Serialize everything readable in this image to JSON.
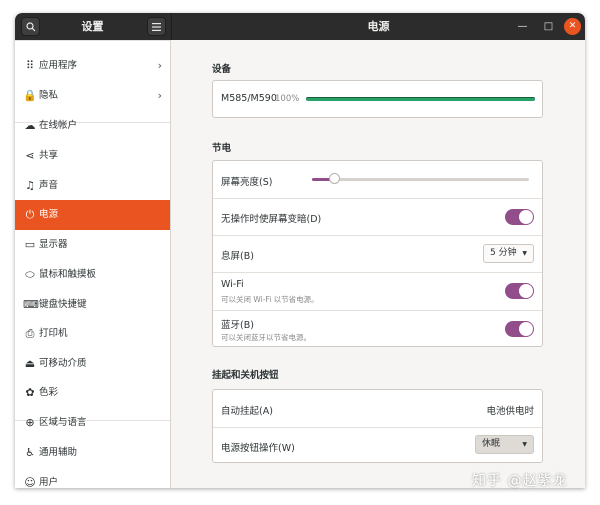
{
  "titlebar": {
    "sidebar_title": "设置",
    "search_icon": "search-icon",
    "menu_icon": "hamburger-menu-icon",
    "page_title": "电源",
    "minimize_glyph": "—",
    "maximize_glyph": "□",
    "close_glyph": "✕"
  },
  "sidebar": {
    "items": [
      {
        "label": "应用程序",
        "icon": "grid-icon",
        "glyph": "⠿",
        "chevron": "›"
      },
      {
        "label": "隐私",
        "icon": "lock-icon",
        "glyph": "🔒",
        "chevron": "›"
      },
      {
        "label": "在线帐户",
        "icon": "cloud-icon",
        "glyph": "☁"
      },
      {
        "label": "共享",
        "icon": "share-icon",
        "glyph": "⋖"
      },
      {
        "label": "声音",
        "icon": "music-note-icon",
        "glyph": "♫"
      },
      {
        "label": "电源",
        "icon": "power-icon",
        "glyph": "⏻"
      },
      {
        "label": "显示器",
        "icon": "monitor-icon",
        "glyph": "▭"
      },
      {
        "label": "鼠标和触摸板",
        "icon": "mouse-icon",
        "glyph": "⬭"
      },
      {
        "label": "键盘快捷键",
        "icon": "keyboard-icon",
        "glyph": "⌨"
      },
      {
        "label": "打印机",
        "icon": "printer-icon",
        "glyph": "⎙"
      },
      {
        "label": "可移动介质",
        "icon": "removable-media-icon",
        "glyph": "⏏"
      },
      {
        "label": "色彩",
        "icon": "color-icon",
        "glyph": "✿"
      },
      {
        "label": "区域与语言",
        "icon": "globe-icon",
        "glyph": "⊕"
      },
      {
        "label": "通用辅助",
        "icon": "accessibility-icon",
        "glyph": "♿"
      },
      {
        "label": "用户",
        "icon": "users-icon",
        "glyph": "☺"
      }
    ],
    "active_index": 5
  },
  "devices": {
    "title": "设备",
    "device_name": "M585/M590",
    "battery_text": "100%",
    "battery_level": 1.0
  },
  "power_saving": {
    "title": "节电",
    "brightness_label": "屏幕亮度(S)",
    "brightness_level": 0.1,
    "dim_label": "无操作时使屏幕变暗(D)",
    "dim_on": true,
    "blank_label": "息屏(B)",
    "blank_value": "5 分钟",
    "wifi_label": "Wi-Fi",
    "wifi_sub": "可以关闭 Wi-Fi 以节省电源。",
    "wifi_on": true,
    "bt_label": "蓝牙(B)",
    "bt_sub": "可以关闭蓝牙以节省电源。",
    "bt_on": true
  },
  "suspend": {
    "title": "挂起和关机按钮",
    "auto_suspend_label": "自动挂起(A)",
    "auto_suspend_value": "电池供电时",
    "power_button_label": "电源按钮操作(W)",
    "power_button_value": "休眠"
  },
  "watermark": "知乎 @赵紫龙",
  "colors": {
    "accent": "#e95420",
    "toggle_on": "#924d8b",
    "battery": "#26a269",
    "titlebar": "#2c2c2c"
  }
}
